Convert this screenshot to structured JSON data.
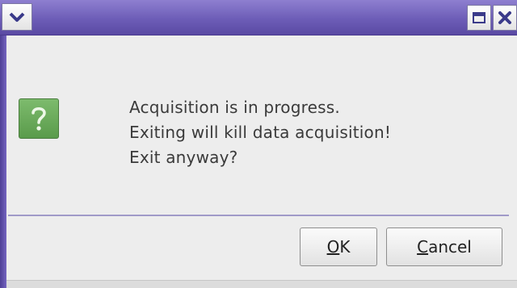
{
  "window": {
    "menu_icon": "chevron-down-icon",
    "maximize_icon": "maximize-icon",
    "close_icon": "close-icon"
  },
  "dialog": {
    "icon": "question-mark-icon",
    "message_lines": [
      "Acquisition is in progress.",
      "Exiting will kill data acquisition!",
      "Exit anyway?"
    ]
  },
  "buttons": {
    "ok": {
      "mnemonic": "O",
      "rest": "K"
    },
    "cancel": {
      "mnemonic": "C",
      "rest": "ancel"
    }
  },
  "colors": {
    "titlebar": "#6d5db7",
    "icon_green": "#5a9b4b",
    "background": "#ededed"
  }
}
